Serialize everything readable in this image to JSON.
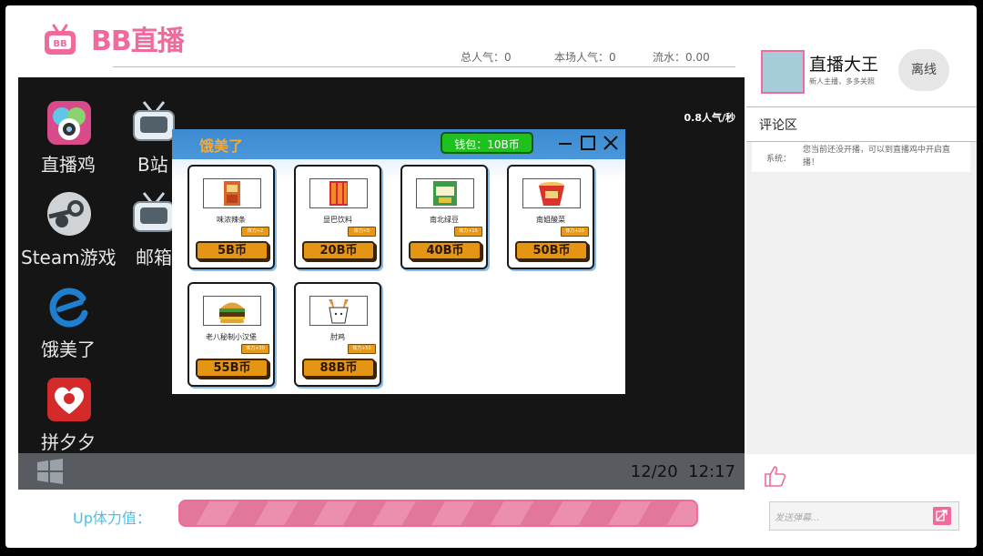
{
  "brand": {
    "logo_text": "BB直播",
    "tv_badge": "BB"
  },
  "header": {
    "stats": [
      {
        "label": "总人气：0"
      },
      {
        "label": "本场人气：0"
      },
      {
        "label": "流水：0.00"
      }
    ]
  },
  "desktop": {
    "popularity_rate": "0.8人气/秒",
    "icons": [
      {
        "label": "直播鸡",
        "icon": "camera-app-icon"
      },
      {
        "label": "B站",
        "icon": "tv-icon"
      },
      {
        "label": "Steam游戏",
        "icon": "steam-icon"
      },
      {
        "label": "邮箱",
        "icon": "tv-icon"
      },
      {
        "label": "饿美了",
        "icon": "food-app-icon"
      },
      {
        "label": "拼夕夕",
        "icon": "shopping-heart-icon"
      }
    ],
    "taskbar": {
      "date": "12/20",
      "time": "12:17"
    }
  },
  "shop": {
    "title": "饿美了",
    "wallet": "钱包：10B币",
    "items": [
      {
        "name": "味浓辣条",
        "tag": "体力+2",
        "price": "5B币"
      },
      {
        "name": "显巴饮料",
        "tag": "体力+5",
        "price": "20B币"
      },
      {
        "name": "南北绿豆",
        "tag": "体力+15",
        "price": "40B币"
      },
      {
        "name": "南姐酸菜",
        "tag": "体力+20",
        "price": "50B币"
      },
      {
        "name": "老八秘制小汉堡",
        "tag": "体力+30",
        "price": "55B币"
      },
      {
        "name": "肘鸡",
        "tag": "体力+50",
        "price": "88B币"
      }
    ]
  },
  "stamina": {
    "label": "Up体力值："
  },
  "streamer": {
    "name": "直播大王",
    "subtitle": "新人主播，多多关照",
    "status_button": "离线"
  },
  "comments": {
    "title": "评论区",
    "messages": [
      {
        "sender": "系统：",
        "text": "您当前还没开播，可以到直播鸡中开启直播！"
      }
    ]
  },
  "danmu": {
    "placeholder": "发送弹幕..."
  },
  "colors": {
    "brand_pink": "#f06a9d",
    "accent_orange": "#e49513",
    "wallet_green": "#1ec11e",
    "window_blue": "#3d8ad0"
  }
}
